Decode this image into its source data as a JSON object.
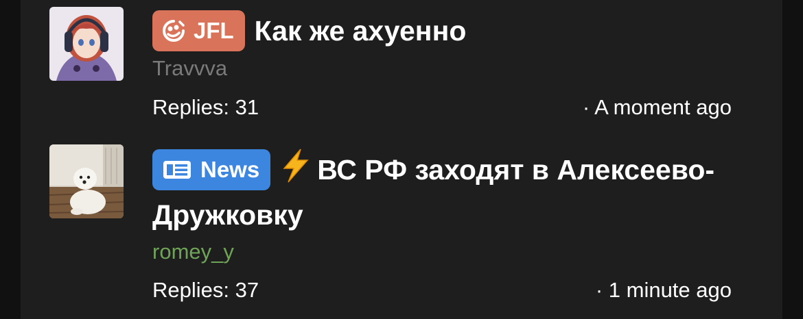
{
  "threads": [
    {
      "tag": {
        "label": "JFL",
        "color": "#d9745a",
        "icon": "jfl-logo-icon"
      },
      "title": "Как же ахуенно",
      "author": "Travvva",
      "replies": "Replies: 31",
      "time": "· A moment ago"
    },
    {
      "tag": {
        "label": "News",
        "color": "#3d86e0",
        "icon": "newspaper-icon"
      },
      "title_prefix": "⚡",
      "title": "ВС РФ заходят в Алексеево-Дружковку",
      "author": "romey_y",
      "replies": "Replies: 37",
      "time": "· 1 minute ago"
    }
  ],
  "colors": {
    "background": "#1e1e1e",
    "author_default": "#7a7a7a",
    "author_highlight": "#6fa458"
  }
}
